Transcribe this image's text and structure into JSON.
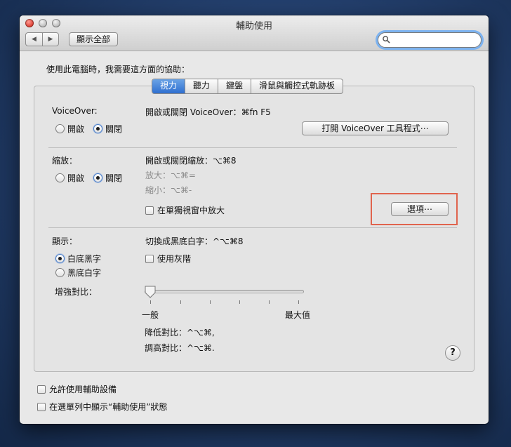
{
  "window": {
    "title": "輔助使用"
  },
  "toolbar": {
    "back": "◀",
    "forward": "▶",
    "show_all": "顯示全部",
    "search_placeholder": ""
  },
  "prompt": "使用此電腦時，我需要這方面的協助：",
  "tabs": [
    {
      "label": "視力",
      "active": true
    },
    {
      "label": "聽力"
    },
    {
      "label": "鍵盤"
    },
    {
      "label": "滑鼠與觸控式軌跡板"
    }
  ],
  "voiceover": {
    "label": "VoiceOver:",
    "on": "開啟",
    "off": "關閉",
    "selected": "off",
    "shortcut": "開啟或關閉 VoiceOver：⌘fn F5",
    "utility_button": "打開 VoiceOver 工具程式⋯"
  },
  "zoom": {
    "label": "縮放：",
    "on": "開啟",
    "off": "關閉",
    "selected": "off",
    "shortcut": "開啟或關閉縮放：⌥⌘8",
    "zoom_in": "放大：⌥⌘=",
    "zoom_out": "縮小：⌥⌘-",
    "separate_window": "在單獨視窗中放大",
    "options_button": "選項⋯"
  },
  "display": {
    "label": "顯示：",
    "black_on_white": "白底黑字",
    "white_on_black": "黑底白字",
    "selected": "black_on_white",
    "invert_shortcut": "切換成黑底白字：^⌥⌘8",
    "grayscale": "使用灰階",
    "contrast_label": "增強對比：",
    "contrast_min": "一般",
    "contrast_max": "最大值",
    "contrast_value": 0,
    "decrease_contrast": "降低對比：^⌥⌘,",
    "increase_contrast": "調高對比：^⌥⌘."
  },
  "help": "?",
  "footer": {
    "enable_assistive": "允許使用輔助設備",
    "show_in_menubar": "在選單列中顯示“輔助使用”狀態"
  },
  "colors": {
    "accent": "#2f6fd0",
    "highlight": "#e0644e"
  }
}
